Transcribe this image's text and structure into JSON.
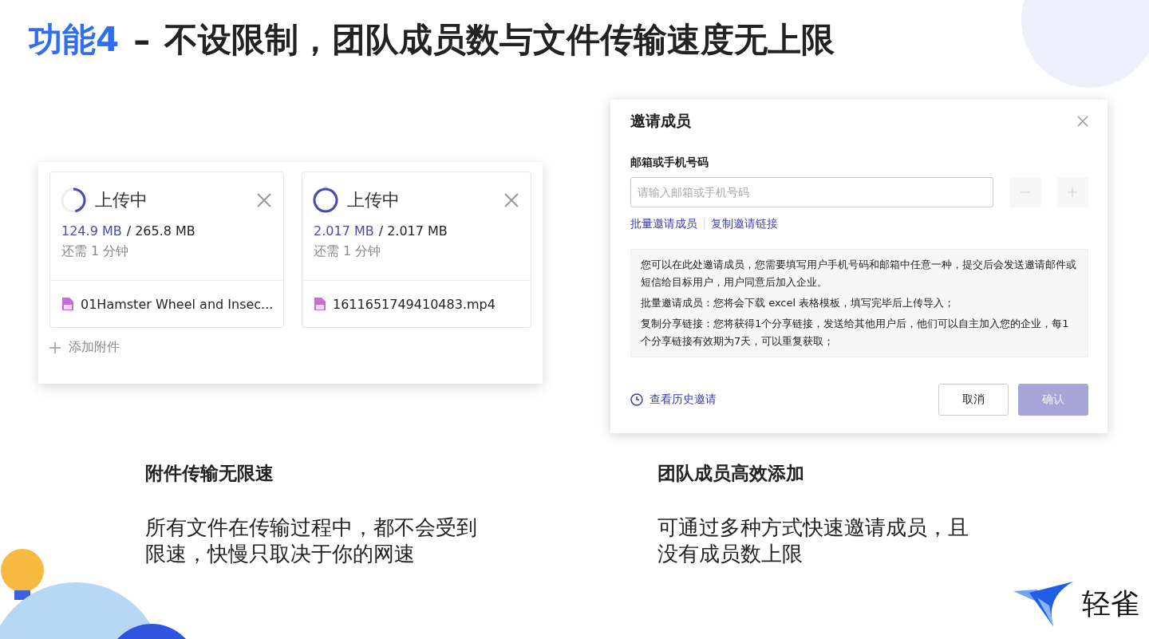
{
  "title": {
    "label": "功能4",
    "separator": "–",
    "text": "不设限制，团队成员数与文件传输速度无上限"
  },
  "uploads": [
    {
      "status": "上传中",
      "done": "124.9 MB",
      "total": "/ 265.8 MB",
      "remaining": "还需 1 分钟",
      "file": "01Hamster Wheel and Insec...",
      "level": 0.47
    },
    {
      "status": "上传中",
      "done": "2.017 MB",
      "total": "/ 2.017 MB",
      "remaining": "还需 1 分钟",
      "file": "1611651749410483.mp4",
      "level": 1
    }
  ],
  "add_attachment": "添加附件",
  "dialog": {
    "title": "邀请成员",
    "field_label": "邮箱或手机号码",
    "placeholder": "请输入邮箱或手机号码",
    "links": [
      "批量邀请成员",
      "复制邀请链接"
    ],
    "info": [
      "您可以在此处邀请成员，您需要填写用户手机号码和邮箱中任意一种，提交后会发送邀请邮件或短信给目标用户，用户同意后加入企业。",
      "批量邀请成员：您将会下载 excel 表格模板，填写完毕后上传导入；",
      "复制分享链接：您将获得1个分享链接，发送给其他用户后，他们可以自主加入您的企业，每1个分享链接有效期为7天，可以重复获取；"
    ],
    "history": "查看历史邀请",
    "cancel": "取消",
    "confirm": {
      "label": "确认",
      "disabled": true
    }
  },
  "captions": [
    {
      "heading": "附件传输无限速",
      "body": "所有文件在传输过程中，都不会受到限速，快慢只取决于你的网速"
    },
    {
      "heading": "团队成员高效添加",
      "body": "可通过多种方式快速邀请成员，且没有成员数上限"
    }
  ],
  "logo": {
    "text": "轻雀"
  }
}
